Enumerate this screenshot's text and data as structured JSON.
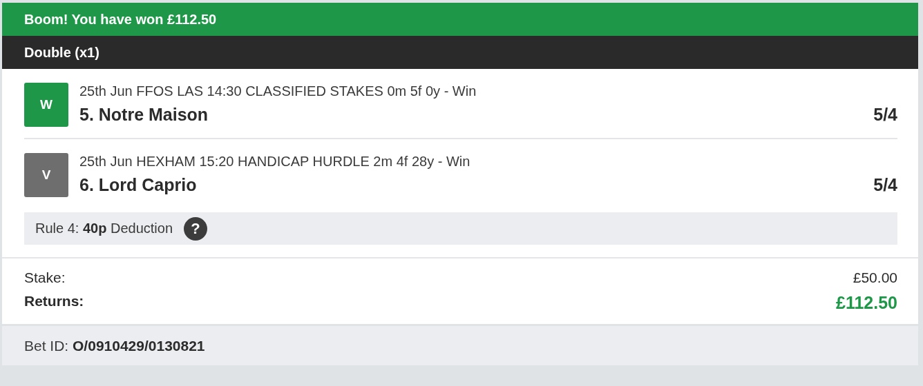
{
  "banner": "Boom! You have won £112.50",
  "bet_type": "Double (x1)",
  "legs": [
    {
      "badge": "W",
      "color": "#1e9848",
      "event": "25th Jun FFOS LAS 14:30 CLASSIFIED STAKES 0m 5f 0y - Win",
      "selection": "5. Notre Maison",
      "odds": "5/4"
    },
    {
      "badge": "V",
      "color": "#6e6e6e",
      "event": "25th Jun HEXHAM 15:20 HANDICAP HURDLE 2m 4f 28y - Win",
      "selection": "6. Lord Caprio",
      "odds": "5/4"
    }
  ],
  "rule4": {
    "text": "Rule 4: **40p** Deduction",
    "help": "?"
  },
  "stake": {
    "label": "Stake:",
    "value": "£50.00"
  },
  "returns": {
    "label": "Returns:",
    "value": "£112.50"
  },
  "bet_id": "Bet ID: **O/0910429/0130821**"
}
